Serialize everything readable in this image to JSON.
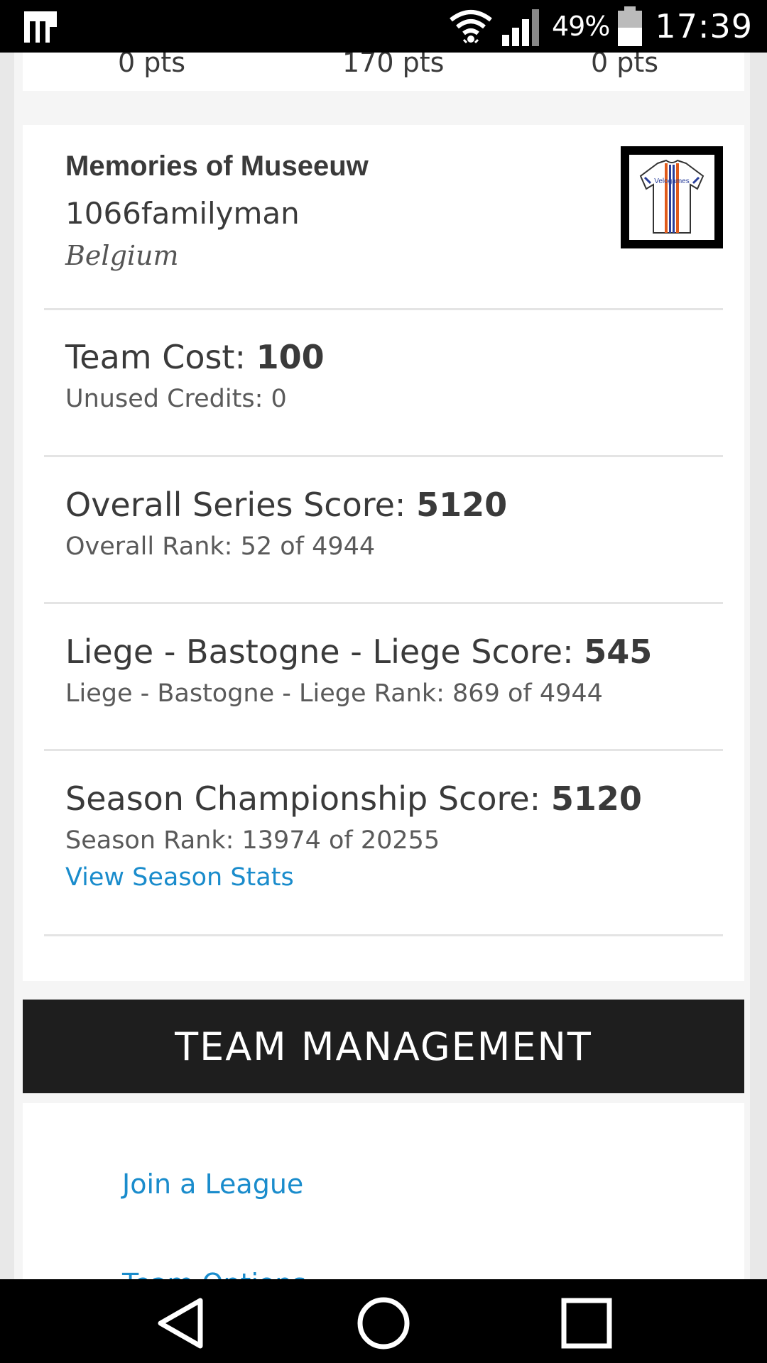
{
  "status_bar": {
    "battery_percent": "49%",
    "time": "17:39",
    "icons": [
      "app-notification-icon",
      "wifi-icon",
      "signal-icon",
      "battery-icon"
    ]
  },
  "points_row": {
    "left": "0 pts",
    "middle": "170 pts",
    "right": "0 pts"
  },
  "team": {
    "name": "Memories of Museeuw",
    "username": "1066familyman",
    "country": "Belgium",
    "jersey_text": "Velogames"
  },
  "stats": {
    "team_cost_label": "Team Cost: ",
    "team_cost_value": "100",
    "unused_credits": "Unused Credits: 0",
    "overall_label": "Overall Series Score: ",
    "overall_value": "5120",
    "overall_rank": "Overall Rank: 52 of 4944",
    "race_label": "Liege - Bastogne - Liege Score: ",
    "race_value": "545",
    "race_rank": "Liege - Bastogne - Liege Rank: 869 of 4944",
    "season_label": "Season Championship Score: ",
    "season_value": "5120",
    "season_rank": "Season Rank: 13974 of 20255",
    "season_link": "View Season Stats"
  },
  "team_management": {
    "title": "TEAM MANAGEMENT",
    "links": [
      "Join a League",
      "Team Options"
    ]
  },
  "colors": {
    "link": "#1a8ccc",
    "header_bar": "#1e1e1e",
    "text": "#3a3a3a"
  }
}
